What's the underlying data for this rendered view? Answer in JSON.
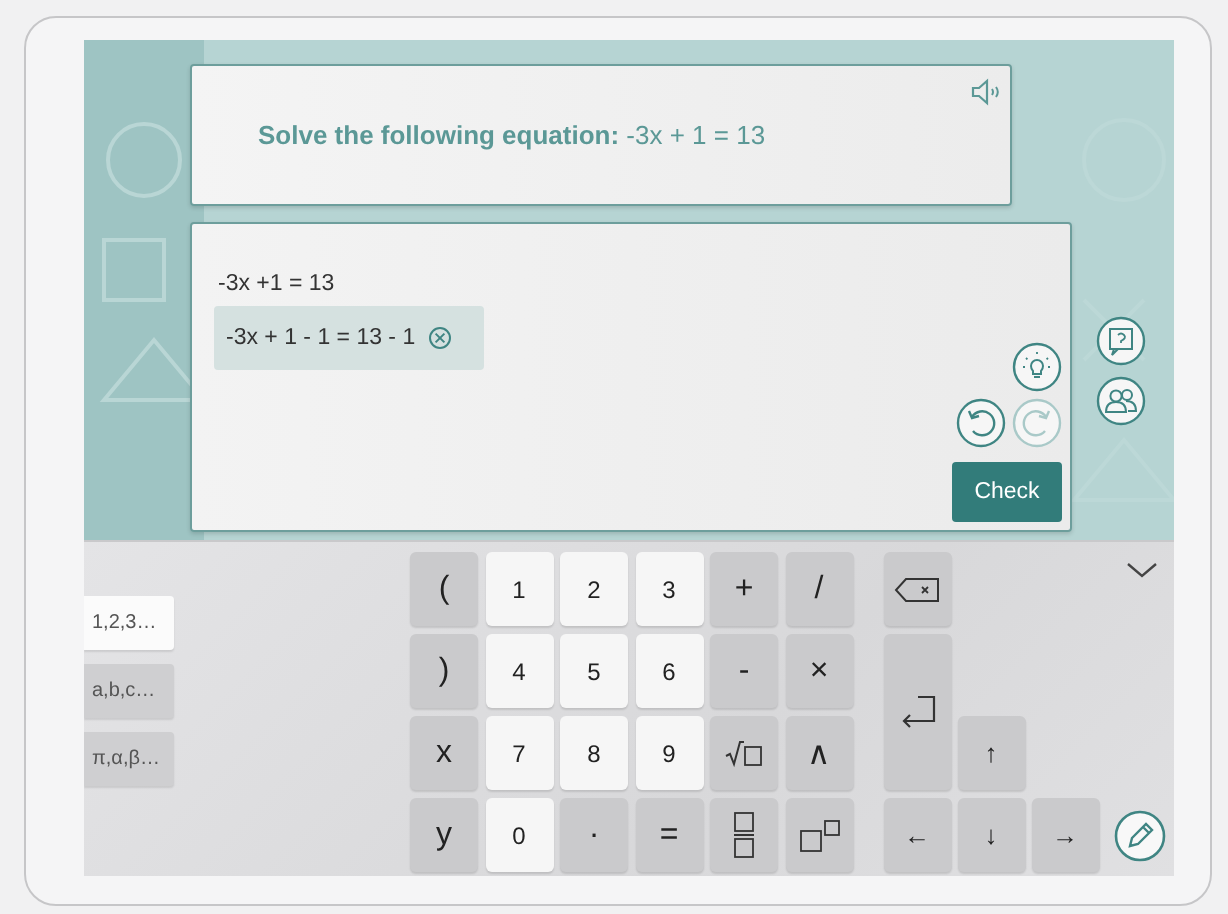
{
  "question": {
    "label": "Solve the following equation:",
    "equation": "-3x + 1 = 13"
  },
  "work": {
    "steps": [
      {
        "text": "-3x +1 = 13",
        "highlighted": false
      },
      {
        "text": "-3x + 1 - 1 = 13 - 1",
        "highlighted": true
      }
    ],
    "undo": {
      "disabled": false
    },
    "redo": {
      "disabled": true
    },
    "check_button": "Check"
  },
  "keyboard": {
    "tabs": [
      {
        "label": "1,2,3…",
        "selected": true
      },
      {
        "label": "a,b,c…",
        "selected": false
      },
      {
        "label": "π,α,β…",
        "selected": false
      }
    ],
    "keys": [
      {
        "kind": "op",
        "label": "("
      },
      {
        "kind": "digit",
        "label": "1"
      },
      {
        "kind": "digit",
        "label": "2"
      },
      {
        "kind": "digit",
        "label": "3"
      },
      {
        "kind": "op",
        "label": "+"
      },
      {
        "kind": "op",
        "label": "/"
      },
      {
        "kind": "op",
        "label": ")"
      },
      {
        "kind": "digit",
        "label": "4"
      },
      {
        "kind": "digit",
        "label": "5"
      },
      {
        "kind": "digit",
        "label": "6"
      },
      {
        "kind": "op",
        "label": "-"
      },
      {
        "kind": "op",
        "label": "×"
      },
      {
        "kind": "op",
        "label": "x"
      },
      {
        "kind": "digit",
        "label": "7"
      },
      {
        "kind": "digit",
        "label": "8"
      },
      {
        "kind": "digit",
        "label": "9"
      },
      {
        "kind": "sqrt"
      },
      {
        "kind": "op",
        "label": "∧"
      },
      {
        "kind": "op",
        "label": "y"
      },
      {
        "kind": "digit",
        "label": "0"
      },
      {
        "kind": "op",
        "label": "·"
      },
      {
        "kind": "op",
        "label": "="
      },
      {
        "kind": "fraction"
      },
      {
        "kind": "power"
      }
    ],
    "nav_keys": [
      {
        "kind": "backspace"
      },
      {
        "kind": "enter"
      },
      {
        "kind": "arrow",
        "label": "↑"
      },
      {
        "kind": "arrow",
        "label": "←"
      },
      {
        "kind": "arrow",
        "label": "↓"
      },
      {
        "kind": "arrow",
        "label": "→"
      }
    ]
  }
}
